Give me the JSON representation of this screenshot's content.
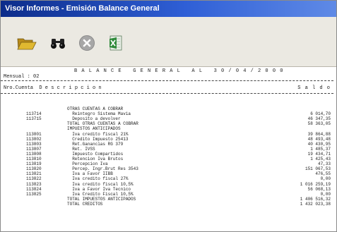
{
  "window": {
    "title": "Visor Informes - Emisión Balance General"
  },
  "toolbar": {
    "open": {
      "icon": "folder-open-icon"
    },
    "find": {
      "icon": "binoculars-icon"
    },
    "close": {
      "icon": "close-circle-icon"
    },
    "export": {
      "icon": "excel-export-icon"
    }
  },
  "report": {
    "title": "B A L A N C E   G E N E R A L   A L   3 0 / 0 4 / 2 0 0 0",
    "subtitle": "Mensual : 02",
    "columns": {
      "left": "Nro.Cuenta  D e s c r i p c i o n",
      "right": "S a l d o"
    },
    "rows": [
      {
        "account": "",
        "description": "OTRAS CUENTAS A COBRAR",
        "value": ""
      },
      {
        "account": "113714",
        "description": "  Reintegro Sistema Mavia",
        "value": "6 014,70"
      },
      {
        "account": "113715",
        "description": "  Deposito a devolver",
        "value": "46 347,35"
      },
      {
        "account": "",
        "description": "TOTAL OTRAS CUENTAS A COBRAR",
        "value": "58 363,05"
      },
      {
        "account": "",
        "description": "IMPUESTOS ANTICIPADOS",
        "value": ""
      },
      {
        "account": "113801",
        "description": "  Iva credito fiscal 21%",
        "value": "39 864,88"
      },
      {
        "account": "113802",
        "description": "  Credito Impuesto 25413",
        "value": "48 493,48"
      },
      {
        "account": "113803",
        "description": "  Ret.Ganancias RG 379",
        "value": "40 430,95"
      },
      {
        "account": "113807",
        "description": "  Ret. IVSS",
        "value": "1 485,37"
      },
      {
        "account": "113808",
        "description": "  Impuesto Compartidos",
        "value": "19 434,71"
      },
      {
        "account": "113810",
        "description": "  Retencion Iva Brutos",
        "value": "1 425,43"
      },
      {
        "account": "113819",
        "description": "  Percepcion Iva",
        "value": "47,33"
      },
      {
        "account": "113820",
        "description": "  Percep. Ingr.Brut Res 3543",
        "value": "151 067,53"
      },
      {
        "account": "113821",
        "description": "  Iva a Favor IIBB",
        "value": "476,55"
      },
      {
        "account": "113822",
        "description": "  Iva credito fiscal 27%",
        "value": "0,00"
      },
      {
        "account": "113823",
        "description": "  Iva credito fiscal 10,5%",
        "value": "1 016 259,19"
      },
      {
        "account": "113824",
        "description": "  Iva a Favor Iva Tecnico",
        "value": "56 068,13"
      },
      {
        "account": "113825",
        "description": "  Iva Credito Fiscal 10,5%",
        "value": "0,00"
      },
      {
        "account": "",
        "description": "TOTAL IMPUESTOS ANTICIPADOS",
        "value": "1 406 516,32"
      },
      {
        "account": "",
        "description": "TOTAL CREDITOS",
        "value": "1 432 023,38"
      }
    ]
  },
  "colors": {
    "titlebar": "#1a3fa8",
    "toolbar": "#ebe9e2",
    "folder": "#e0b830",
    "excel": "#2e8a3a"
  }
}
